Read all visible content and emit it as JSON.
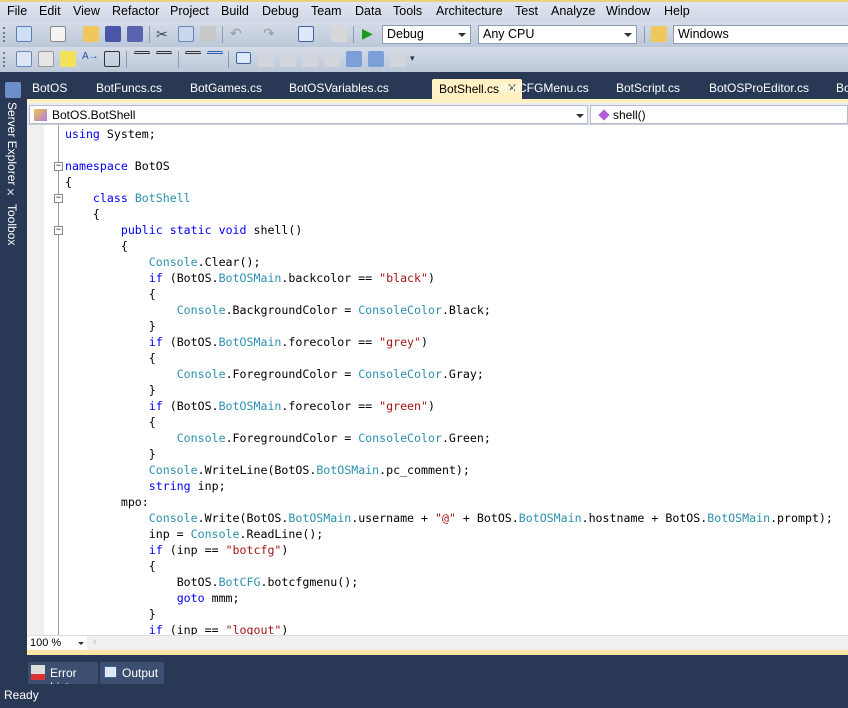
{
  "menu": [
    "File",
    "Edit",
    "View",
    "Refactor",
    "Project",
    "Build",
    "Debug",
    "Team",
    "Data",
    "Tools",
    "Architecture",
    "Test",
    "Analyze",
    "Window",
    "Help"
  ],
  "toolbar": {
    "config": "Debug",
    "platform": "Any CPU",
    "find": "Windows"
  },
  "side_tabs": {
    "server_explorer": "Server Explorer",
    "toolbox": "Toolbox"
  },
  "tabs": [
    {
      "label": "BotOS"
    },
    {
      "label": "BotFuncs.cs"
    },
    {
      "label": "BotGames.cs"
    },
    {
      "label": "BotOSVariables.cs"
    },
    {
      "label": "BotShell.cs",
      "active": true
    },
    {
      "label": "BotCFGMenu.cs"
    },
    {
      "label": "BotScript.cs"
    },
    {
      "label": "BotOSProEditor.cs"
    },
    {
      "label": "Bo"
    }
  ],
  "nav": {
    "type": "BotOS.BotShell",
    "member": "shell()"
  },
  "code": [
    [
      0,
      [
        [
          "k",
          "using"
        ],
        [
          "p",
          " System;"
        ]
      ]
    ],
    [
      0,
      []
    ],
    [
      0,
      [
        [
          "k",
          "namespace"
        ],
        [
          "p",
          " BotOS"
        ]
      ]
    ],
    [
      0,
      [
        [
          "p",
          "{"
        ]
      ]
    ],
    [
      1,
      [
        [
          "k",
          "class"
        ],
        [
          "p",
          " "
        ],
        [
          "t",
          "BotShell"
        ]
      ]
    ],
    [
      1,
      [
        [
          "p",
          "{"
        ]
      ]
    ],
    [
      2,
      [
        [
          "k",
          "public"
        ],
        [
          "p",
          " "
        ],
        [
          "k",
          "static"
        ],
        [
          "p",
          " "
        ],
        [
          "k",
          "void"
        ],
        [
          "p",
          " shell()"
        ]
      ]
    ],
    [
      2,
      [
        [
          "p",
          "{"
        ]
      ]
    ],
    [
      3,
      [
        [
          "t",
          "Console"
        ],
        [
          "p",
          ".Clear();"
        ]
      ]
    ],
    [
      3,
      [
        [
          "k",
          "if"
        ],
        [
          "p",
          " (BotOS."
        ],
        [
          "t",
          "BotOSMain"
        ],
        [
          "p",
          ".backcolor == "
        ],
        [
          "s",
          "\"black\""
        ],
        [
          "p",
          ")"
        ]
      ]
    ],
    [
      3,
      [
        [
          "p",
          "{"
        ]
      ]
    ],
    [
      4,
      [
        [
          "t",
          "Console"
        ],
        [
          "p",
          ".BackgroundColor = "
        ],
        [
          "t",
          "ConsoleColor"
        ],
        [
          "p",
          ".Black;"
        ]
      ]
    ],
    [
      3,
      [
        [
          "p",
          "}"
        ]
      ]
    ],
    [
      3,
      [
        [
          "k",
          "if"
        ],
        [
          "p",
          " (BotOS."
        ],
        [
          "t",
          "BotOSMain"
        ],
        [
          "p",
          ".forecolor == "
        ],
        [
          "s",
          "\"grey\""
        ],
        [
          "p",
          ")"
        ]
      ]
    ],
    [
      3,
      [
        [
          "p",
          "{"
        ]
      ]
    ],
    [
      4,
      [
        [
          "t",
          "Console"
        ],
        [
          "p",
          ".ForegroundColor = "
        ],
        [
          "t",
          "ConsoleColor"
        ],
        [
          "p",
          ".Gray;"
        ]
      ]
    ],
    [
      3,
      [
        [
          "p",
          "}"
        ]
      ]
    ],
    [
      3,
      [
        [
          "k",
          "if"
        ],
        [
          "p",
          " (BotOS."
        ],
        [
          "t",
          "BotOSMain"
        ],
        [
          "p",
          ".forecolor == "
        ],
        [
          "s",
          "\"green\""
        ],
        [
          "p",
          ")"
        ]
      ]
    ],
    [
      3,
      [
        [
          "p",
          "{"
        ]
      ]
    ],
    [
      4,
      [
        [
          "t",
          "Console"
        ],
        [
          "p",
          ".ForegroundColor = "
        ],
        [
          "t",
          "ConsoleColor"
        ],
        [
          "p",
          ".Green;"
        ]
      ]
    ],
    [
      3,
      [
        [
          "p",
          "}"
        ]
      ]
    ],
    [
      3,
      [
        [
          "t",
          "Console"
        ],
        [
          "p",
          ".WriteLine(BotOS."
        ],
        [
          "t",
          "BotOSMain"
        ],
        [
          "p",
          ".pc_comment);"
        ]
      ]
    ],
    [
      3,
      [
        [
          "k",
          "string"
        ],
        [
          "p",
          " inp;"
        ]
      ]
    ],
    [
      2,
      [
        [
          "p",
          "mpo:"
        ]
      ]
    ],
    [
      3,
      [
        [
          "t",
          "Console"
        ],
        [
          "p",
          ".Write(BotOS."
        ],
        [
          "t",
          "BotOSMain"
        ],
        [
          "p",
          ".username + "
        ],
        [
          "s",
          "\"@\""
        ],
        [
          "p",
          " + BotOS."
        ],
        [
          "t",
          "BotOSMain"
        ],
        [
          "p",
          ".hostname + BotOS."
        ],
        [
          "t",
          "BotOSMain"
        ],
        [
          "p",
          ".prompt);"
        ]
      ]
    ],
    [
      3,
      [
        [
          "p",
          "inp = "
        ],
        [
          "t",
          "Console"
        ],
        [
          "p",
          ".ReadLine();"
        ]
      ]
    ],
    [
      3,
      [
        [
          "k",
          "if"
        ],
        [
          "p",
          " (inp == "
        ],
        [
          "s",
          "\"botcfg\""
        ],
        [
          "p",
          ")"
        ]
      ]
    ],
    [
      3,
      [
        [
          "p",
          "{"
        ]
      ]
    ],
    [
      4,
      [
        [
          "p",
          "BotOS."
        ],
        [
          "t",
          "BotCFG"
        ],
        [
          "p",
          ".botcfgmenu();"
        ]
      ]
    ],
    [
      4,
      [
        [
          "k",
          "goto"
        ],
        [
          "p",
          " mmm;"
        ]
      ]
    ],
    [
      3,
      [
        [
          "p",
          "}"
        ]
      ]
    ],
    [
      3,
      [
        [
          "k",
          "if"
        ],
        [
          "p",
          " (inp == "
        ],
        [
          "s",
          "\"logout\""
        ],
        [
          "p",
          ")"
        ]
      ]
    ]
  ],
  "zoom": "100 %",
  "bottom_tabs": {
    "error_list": "Error List",
    "output": "Output"
  },
  "status": "Ready",
  "colors": {
    "keyword": "#0000ff",
    "type": "#2b91af",
    "string": "#a31515",
    "chrome": "#293955",
    "active_tab": "#fff1c4"
  }
}
